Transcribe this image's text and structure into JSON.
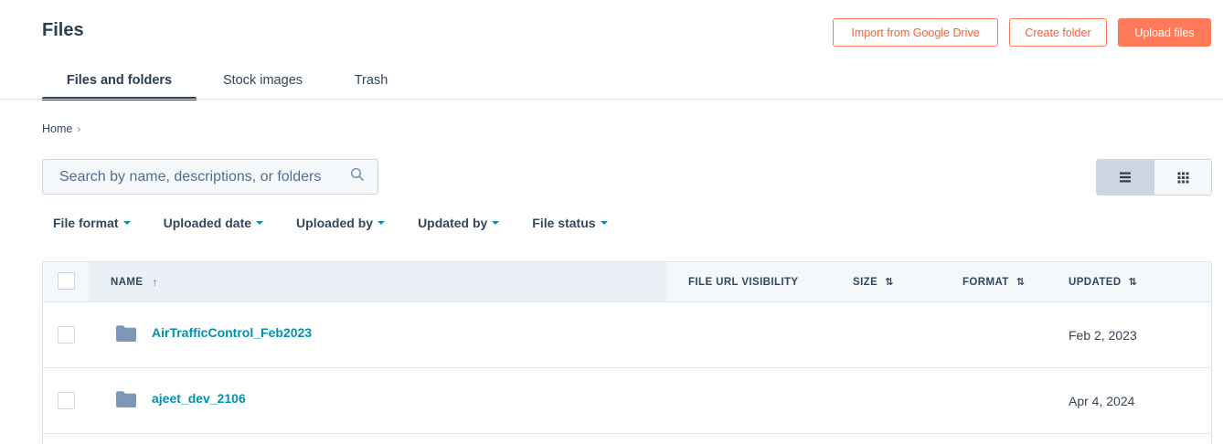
{
  "page": {
    "title": "Files"
  },
  "actions": {
    "import_label": "Import from Google Drive",
    "create_label": "Create folder",
    "upload_label": "Upload files"
  },
  "tabs": [
    {
      "label": "Files and folders",
      "active": true
    },
    {
      "label": "Stock images",
      "active": false
    },
    {
      "label": "Trash",
      "active": false
    }
  ],
  "breadcrumb": {
    "home": "Home",
    "separator": "›"
  },
  "search": {
    "placeholder": "Search by name, descriptions, or folders",
    "value": "",
    "icon": "search-icon"
  },
  "view_toggle": {
    "selected": "list",
    "options": [
      "list-icon",
      "grid-icon"
    ]
  },
  "filters": [
    {
      "label": "File format"
    },
    {
      "label": "Uploaded date"
    },
    {
      "label": "Uploaded by"
    },
    {
      "label": "Updated by"
    },
    {
      "label": "File status"
    }
  ],
  "table": {
    "columns": {
      "name": "NAME",
      "visibility": "FILE URL VISIBILITY",
      "size": "SIZE",
      "format": "FORMAT",
      "updated": "UPDATED"
    },
    "sort": {
      "column": "name",
      "direction": "ascending",
      "arrow": "↑",
      "sortable_glyph": "⇅"
    },
    "rows": [
      {
        "name": "AirTrafficControl_Feb2023",
        "type": "folder",
        "updated": "Feb 2, 2023"
      },
      {
        "name": "ajeet_dev_2106",
        "type": "folder",
        "updated": "Apr 4, 2024"
      }
    ]
  },
  "colors": {
    "accent": "#ff7a59",
    "link": "#0091ae",
    "text": "#33475b",
    "folder_icon": "#7c98b6",
    "header_bg": "#f5f8fa"
  }
}
